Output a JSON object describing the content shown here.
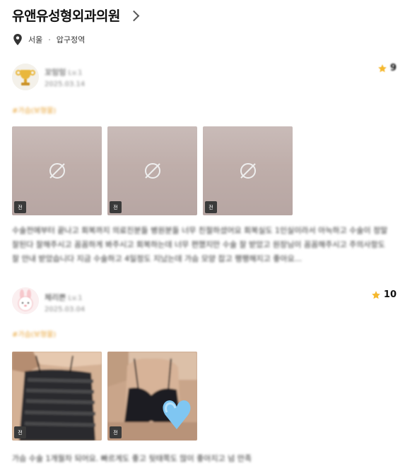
{
  "header": {
    "clinic_name": "유앤유성형외과의원",
    "location_city": "서울",
    "location_area": "압구정역"
  },
  "reviews": [
    {
      "username": "꼬잉잉",
      "level": "Lv.1",
      "date": "2025.03.14",
      "rating": "9",
      "tag": "#가슴(보형물)",
      "photo_badge": "전",
      "text": "수술전에부터 끝나고 회복까지 의료진분들 병원분들 너무 친절하셨어요 회복실도 1인실이라서 아늑하고 수술이 정말 잘된다 잘해주시고 꼼꼼하게 봐주시고 회복하는데 너무 편했지만 수술 잘 받았고 원장님이 꼼꼼해주시고 주의사항도 잘 안내 받았습니다 지금 수술하고 4일정도 지났는데 가슴 모양 잡고 팽팽해지고 좋아요..."
    },
    {
      "username": "체리쁜",
      "level": "Lv.1",
      "date": "2025.03.04",
      "rating": "10",
      "tag": "#가슴(보형물)",
      "photo_badge": "전",
      "text": "가슴 수술 1개월차 되어요. 빠르게도 좋고 뒷태쪽도 많이 좋아지고 넘 만족"
    }
  ],
  "colors": {
    "star": "#f5b82e",
    "tag": "#e8a233",
    "badge_bg": "#3a3a3a"
  }
}
